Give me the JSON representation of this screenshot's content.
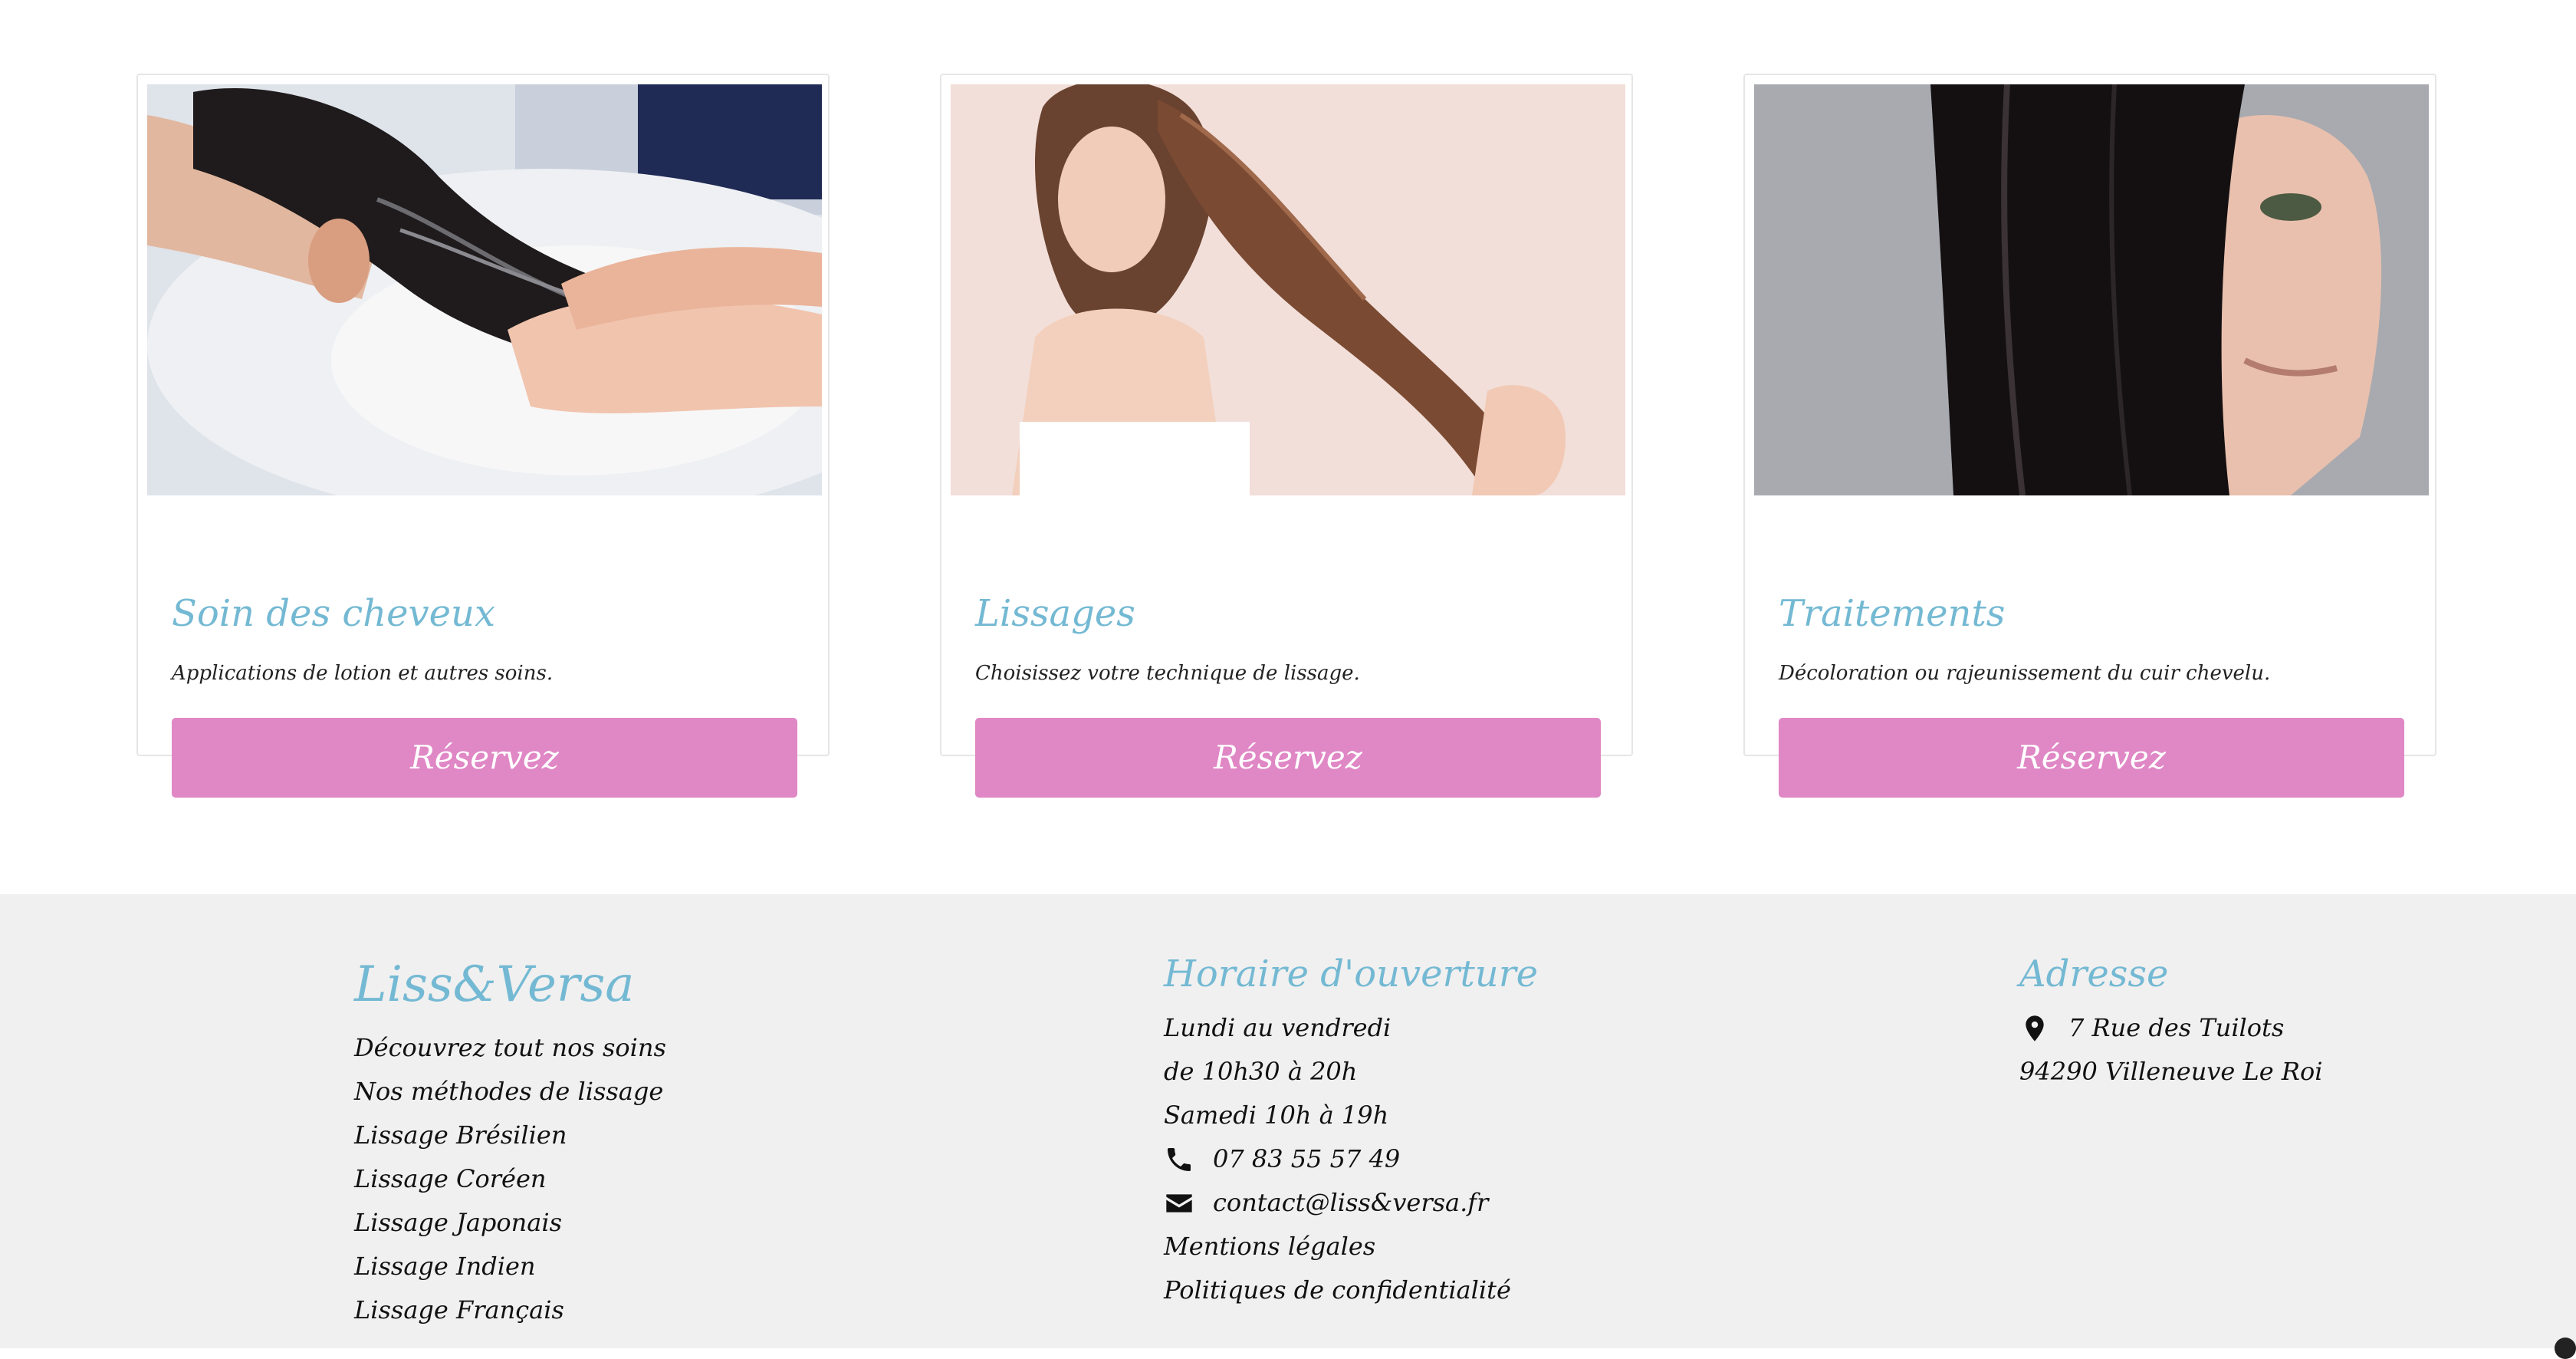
{
  "services": [
    {
      "title": "Soin des cheveux",
      "description": "Applications de lotion et autres soins.",
      "button_label": "Réservez",
      "image": "hair-washing-photo"
    },
    {
      "title": "Lissages",
      "description": "Choisissez votre technique de lissage.",
      "button_label": "Réservez",
      "image": "long-straight-hair-photo"
    },
    {
      "title": "Traitements",
      "description": "Décoloration ou rajeunissement du cuir chevelu.",
      "button_label": "Réservez",
      "image": "sleek-dark-hair-photo"
    }
  ],
  "footer": {
    "brand": "Liss&Versa",
    "links": [
      "Découvrez tout nos soins",
      "Nos méthodes de lissage",
      "Lissage Brésilien",
      "Lissage Coréen",
      "Lissage Japonais",
      "Lissage Indien",
      "Lissage Français"
    ],
    "hours": {
      "title": "Horaire d'ouverture",
      "lines": [
        "Lundi au vendredi",
        "de 10h30 à 20h",
        "Samedi 10h à 19h"
      ],
      "phone": "07 83 55 57 49",
      "email": "contact@liss&versa.fr",
      "legal": "Mentions légales",
      "privacy": "Politiques de confidentialité"
    },
    "address": {
      "title": "Adresse",
      "street": "7 Rue des Tuilots",
      "city": "94290 Villeneuve Le Roi"
    }
  },
  "colors": {
    "accent_blue": "#74b9d3",
    "button_pink": "#e087c5",
    "footer_bg": "#f0f0f0"
  },
  "icons": [
    "map-marker-icon",
    "phone-icon",
    "envelope-icon"
  ]
}
